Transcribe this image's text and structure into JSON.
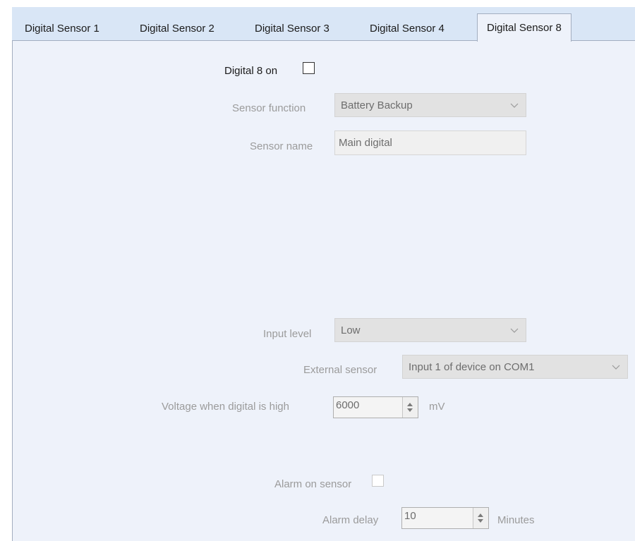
{
  "tabs": [
    {
      "label": "Digital Sensor 1"
    },
    {
      "label": "Digital Sensor 2"
    },
    {
      "label": "Digital Sensor 3"
    },
    {
      "label": "Digital Sensor 4"
    },
    {
      "label": "Digital Sensor 8",
      "active": true
    }
  ],
  "form": {
    "enable_label": "Digital 8 on",
    "enable_checked": false,
    "sensor_function": {
      "label": "Sensor function",
      "value": "Battery Backup"
    },
    "sensor_name": {
      "label": "Sensor name",
      "value": "Main digital"
    },
    "input_level": {
      "label": "Input level",
      "value": "Low"
    },
    "external_sensor": {
      "label": "External sensor",
      "value": "Input 1 of device on COM1"
    },
    "voltage": {
      "label": "Voltage when digital is high",
      "value": "6000",
      "unit": "mV"
    },
    "alarm_on_sensor": {
      "label": "Alarm on sensor",
      "checked": false
    },
    "alarm_delay": {
      "label": "Alarm delay",
      "value": "10",
      "unit": "Minutes"
    }
  },
  "icons": {
    "dropdown": "chevron-down-icon",
    "spinner_up": "spinner-up-icon",
    "spinner_down": "spinner-down-icon"
  }
}
